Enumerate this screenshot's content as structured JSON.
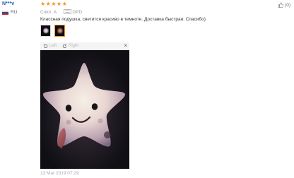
{
  "reviewer": {
    "name": "N***v",
    "country_code": "RU"
  },
  "rating": {
    "stars": 5,
    "max": 5,
    "star_color": "#f29522"
  },
  "meta": {
    "color_label": "Color:",
    "color_value": "A",
    "shipping_value": "DPD"
  },
  "review_text": "Классная подушка, светится красиво в темноте. Доставка быстрая. Спасибо)",
  "helpful": {
    "count": "(0)"
  },
  "photos": {
    "count": 2,
    "active_index": 1
  },
  "viewer": {
    "left_label": "Left",
    "right_label": "Right",
    "close_icon": "close-icon",
    "close_glyph": "×"
  },
  "date": "13 Mar 2019 07:29",
  "colors": {
    "link": "#1a5fb4",
    "accent": "#f29522"
  }
}
